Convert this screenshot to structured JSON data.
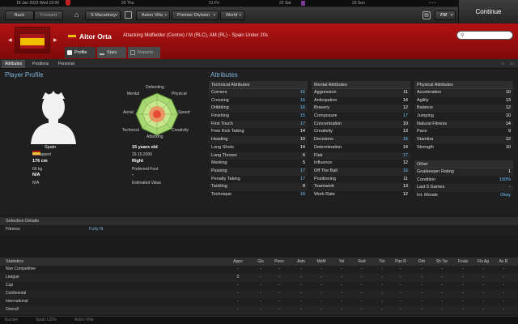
{
  "datebar": {
    "current_date": "19 Jan 2022 Wed 19:00",
    "days": [
      "20 Thu",
      "21 Fri",
      "22 Sat",
      "23 Sun"
    ]
  },
  "nav": {
    "back_label": "Back",
    "forward_label": "Forward",
    "manager": "S Macartney",
    "club": "Aston Villa",
    "division": "Premier Division",
    "world": "World",
    "fm_label": "FM",
    "continue_label": "Continue"
  },
  "player": {
    "name": "Aitor Orta",
    "position_desc": "Attacking Midfielder (Centre) / M (RLC), AM (RL) - Spain Under 20s"
  },
  "tabs": {
    "profile": "Profile",
    "stats": "Stats",
    "reports": "Reports"
  },
  "subtabs": [
    "Attributes",
    "Positions",
    "Personal"
  ],
  "profile": {
    "title": "Player Profile",
    "nationality": "Spain",
    "caps": "Uncapped",
    "height": "176 cm",
    "weight": "66 kg",
    "value1": "N/A",
    "value2": "N/A",
    "age": "15 years old",
    "dob": "29.10.2006",
    "foot": "Right",
    "foot_label": "Preferred Foot",
    "value_dash": "-",
    "value_label": "Estimated Value"
  },
  "radar": {
    "defending": "Defending",
    "physical": "Physical",
    "mental": "Mental",
    "speed": "Speed",
    "aerial": "Aerial",
    "technical": "Technical",
    "creativity": "Creativity",
    "attacking": "Attacking"
  },
  "attributes": {
    "title": "Attributes",
    "technical": {
      "header": "Technical Attributes",
      "rows": [
        {
          "name": "Corners",
          "value": "16"
        },
        {
          "name": "Crossing",
          "value": "16"
        },
        {
          "name": "Dribbling",
          "value": "16"
        },
        {
          "name": "Finishing",
          "value": "15"
        },
        {
          "name": "First Touch",
          "value": "17"
        },
        {
          "name": "Free Kick Taking",
          "value": "14"
        },
        {
          "name": "Heading",
          "value": "10"
        },
        {
          "name": "Long Shots",
          "value": "14"
        },
        {
          "name": "Long Throws",
          "value": "6"
        },
        {
          "name": "Marking",
          "value": "5"
        },
        {
          "name": "Passing",
          "value": "17"
        },
        {
          "name": "Penalty Taking",
          "value": "17"
        },
        {
          "name": "Tackling",
          "value": "8"
        },
        {
          "name": "Technique",
          "value": "18"
        }
      ]
    },
    "mental": {
      "header": "Mental Attributes",
      "rows": [
        {
          "name": "Aggression",
          "value": "11"
        },
        {
          "name": "Anticipation",
          "value": "14"
        },
        {
          "name": "Bravery",
          "value": "12"
        },
        {
          "name": "Composure",
          "value": "17"
        },
        {
          "name": "Concentration",
          "value": "10"
        },
        {
          "name": "Creativity",
          "value": "13"
        },
        {
          "name": "Decisions",
          "value": "16"
        },
        {
          "name": "Determination",
          "value": "14"
        },
        {
          "name": "Flair",
          "value": "17"
        },
        {
          "name": "Influence",
          "value": "12"
        },
        {
          "name": "Off The Ball",
          "value": "16"
        },
        {
          "name": "Positioning",
          "value": "11"
        },
        {
          "name": "Teamwork",
          "value": "13"
        },
        {
          "name": "Work Rate",
          "value": "12"
        }
      ]
    },
    "physical": {
      "header": "Physical Attributes",
      "rows": [
        {
          "name": "Acceleration",
          "value": "10"
        },
        {
          "name": "Agility",
          "value": "13"
        },
        {
          "name": "Balance",
          "value": "12"
        },
        {
          "name": "Jumping",
          "value": "10"
        },
        {
          "name": "Natural Fitness",
          "value": "14"
        },
        {
          "name": "Pace",
          "value": "9"
        },
        {
          "name": "Stamina",
          "value": "12"
        },
        {
          "name": "Strength",
          "value": "10"
        }
      ]
    },
    "other": {
      "header": "Other",
      "rows": [
        {
          "name": "Goalkeeper Rating",
          "value": "1"
        },
        {
          "name": "Condition",
          "value": "100%"
        },
        {
          "name": "Last 5 Games",
          "value": "-"
        },
        {
          "name": "Int. Morale",
          "value": "Okay"
        }
      ]
    }
  },
  "selection": {
    "title": "Selection Details",
    "label": "Fitness",
    "value": "Fully fit"
  },
  "statistics": {
    "title": "Statistics",
    "columns": [
      "Apps",
      "Gls",
      "Pens",
      "Asts",
      "MoM",
      "Yel",
      "Red",
      "Tck",
      "Pas R",
      "Drb",
      "Sh Tar",
      "Fouls",
      "Fls Ag",
      "Av R"
    ],
    "rows": [
      {
        "name": "Non Competitive",
        "cells": [
          "-",
          "-",
          "-",
          "-",
          "-",
          "-",
          "-",
          "-",
          "-",
          "-",
          "-",
          "-",
          "-",
          "-"
        ]
      },
      {
        "name": "League",
        "cells": [
          "0",
          "-",
          "-",
          "-",
          "-",
          "-",
          "-",
          "-",
          "-",
          "-",
          "-",
          "-",
          "-",
          "-"
        ]
      },
      {
        "name": "Cup",
        "cells": [
          "-",
          "-",
          "-",
          "-",
          "-",
          "-",
          "-",
          "-",
          "-",
          "-",
          "-",
          "-",
          "-",
          "-"
        ]
      },
      {
        "name": "Continental",
        "cells": [
          "-",
          "-",
          "-",
          "-",
          "-",
          "-",
          "-",
          "-",
          "-",
          "-",
          "-",
          "-",
          "-",
          "-"
        ]
      },
      {
        "name": "International",
        "cells": [
          "-",
          "-",
          "-",
          "-",
          "-",
          "-",
          "-",
          "-",
          "-",
          "-",
          "-",
          "-",
          "-",
          "-"
        ]
      },
      {
        "name": "Overall",
        "cells": [
          "-",
          "-",
          "-",
          "-",
          "-",
          "-",
          "-",
          "-",
          "-",
          "-",
          "-",
          "-",
          "-",
          "-"
        ]
      }
    ]
  },
  "statusbar": {
    "items": [
      "Europe",
      "Spain U20s",
      "Aston Villa"
    ]
  },
  "colors": {
    "header_red": "#a31010",
    "title_blue": "#7fb3d9",
    "value_blue": "#6cc3ff",
    "radar_green": "#7cc84a"
  }
}
